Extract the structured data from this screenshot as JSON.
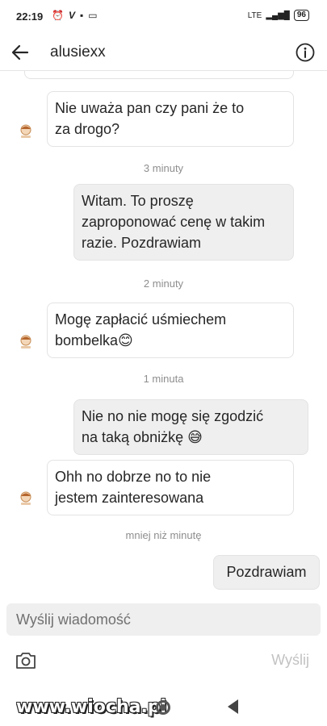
{
  "status_bar": {
    "time": "22:19",
    "icons": [
      "alarm-icon",
      "v-icon",
      "notification-icon",
      "gallery-icon"
    ],
    "network": "LTE",
    "battery": "96"
  },
  "header": {
    "title": "alusiexx",
    "back_icon": "arrow-left-icon",
    "info_icon": "info-circle-icon"
  },
  "messages": [
    {
      "type": "in",
      "text": "Nie uważa pan czy pani że to za drogo?"
    },
    {
      "type": "timestamp",
      "text": "3 minuty"
    },
    {
      "type": "out",
      "text": "Witam. To proszę zaproponować cenę w takim razie. Pozdrawiam"
    },
    {
      "type": "timestamp",
      "text": "2 minuty"
    },
    {
      "type": "in",
      "text": "Mogę zapłacić uśmiechem bombelka😊"
    },
    {
      "type": "timestamp",
      "text": "1 minuta"
    },
    {
      "type": "out",
      "text": "Nie no nie mogę się zgodzić na taką obniżkę 😅"
    },
    {
      "type": "in",
      "text": "Ohh no dobrze no to nie jestem zainteresowana"
    },
    {
      "type": "timestamp",
      "text": "mniej niż minutę"
    },
    {
      "type": "out",
      "text": "Pozdrawiam"
    }
  ],
  "bubbles": {
    "in1_l1": "Nie uważa pan czy pani że to",
    "in1_l2": "za drogo?",
    "ts1": "3 minuty",
    "out1_l1": "Witam. To proszę",
    "out1_l2": "zaproponować cenę w takim",
    "out1_l3": "razie. Pozdrawiam",
    "ts2": "2 minuty",
    "in2_l1": "Mogę zapłacić uśmiechem",
    "in2_l2": "bombelka😊",
    "ts3": "1 minuta",
    "out2_l1": "Nie no nie mogę się zgodzić",
    "out2_l2": "na taką obniżkę 😅",
    "in3_l1": "Ohh no dobrze no to nie",
    "in3_l2": "jestem zainteresowana",
    "ts4": "mniej niż minutę",
    "out3_l1": "Pozdrawiam"
  },
  "composer": {
    "placeholder": "Wyślij wiadomość",
    "send_label": "Wyślij",
    "camera_icon": "camera-icon"
  },
  "watermark": "www.wiocha.pl",
  "colors": {
    "incoming_bg": "#ffffff",
    "outgoing_bg": "#efefef",
    "timestamp": "#8e8e8e",
    "send_disabled": "#c2c2c2"
  }
}
